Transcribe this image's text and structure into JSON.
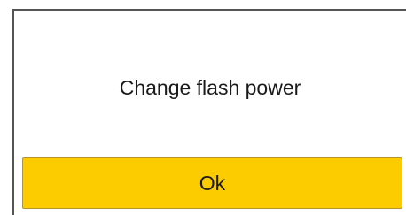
{
  "dialog": {
    "message": "Change flash power",
    "ok_label": "Ok"
  },
  "colors": {
    "button_fill": "#fccb00",
    "border": "#555555",
    "text": "#1a1a1a"
  }
}
